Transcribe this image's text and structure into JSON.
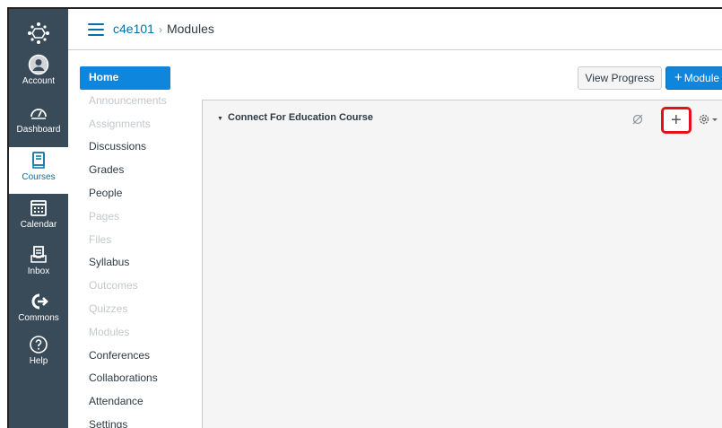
{
  "header": {
    "course_code": "c4e101",
    "separator": "›",
    "current_page": "Modules"
  },
  "global_nav": [
    {
      "label": "Account",
      "icon": "account-icon"
    },
    {
      "label": "Dashboard",
      "icon": "dashboard-icon"
    },
    {
      "label": "Courses",
      "icon": "courses-icon",
      "active": true
    },
    {
      "label": "Calendar",
      "icon": "calendar-icon"
    },
    {
      "label": "Inbox",
      "icon": "inbox-icon"
    },
    {
      "label": "Commons",
      "icon": "commons-icon"
    },
    {
      "label": "Help",
      "icon": "help-icon"
    }
  ],
  "course_nav": [
    {
      "label": "Home",
      "state": "active"
    },
    {
      "label": "Announcements",
      "state": "disabled"
    },
    {
      "label": "Assignments",
      "state": "disabled"
    },
    {
      "label": "Discussions",
      "state": "enabled"
    },
    {
      "label": "Grades",
      "state": "enabled"
    },
    {
      "label": "People",
      "state": "enabled"
    },
    {
      "label": "Pages",
      "state": "disabled"
    },
    {
      "label": "Files",
      "state": "disabled"
    },
    {
      "label": "Syllabus",
      "state": "enabled"
    },
    {
      "label": "Outcomes",
      "state": "disabled"
    },
    {
      "label": "Quizzes",
      "state": "disabled"
    },
    {
      "label": "Modules",
      "state": "disabled"
    },
    {
      "label": "Conferences",
      "state": "enabled"
    },
    {
      "label": "Collaborations",
      "state": "enabled"
    },
    {
      "label": "Attendance",
      "state": "enabled"
    },
    {
      "label": "Settings",
      "state": "enabled"
    }
  ],
  "toolbar": {
    "view_progress_label": "View Progress",
    "add_module_label": "Module",
    "add_module_plus": "+"
  },
  "module": {
    "title": "Connect For Education Course",
    "caret": "▼",
    "add_item_symbol": "+",
    "highlight_color": "#e5101b"
  },
  "colors": {
    "nav_bg": "#394b58",
    "accent": "#0770a3",
    "primary_button": "#0e86dd"
  }
}
